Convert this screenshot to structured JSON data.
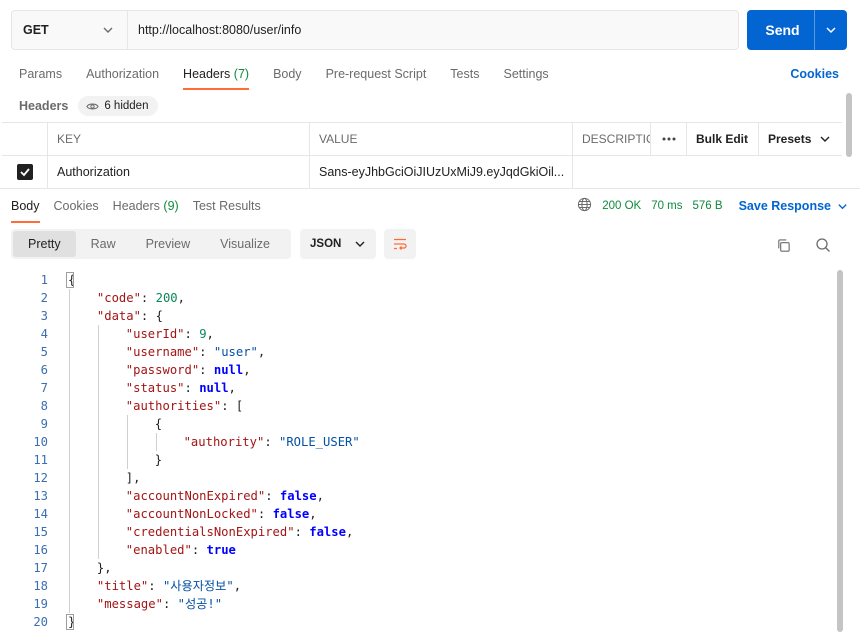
{
  "request": {
    "method": "GET",
    "url": "http://localhost:8080/user/info",
    "send_label": "Send"
  },
  "request_tabs": [
    {
      "label": "Params",
      "count": ""
    },
    {
      "label": "Authorization",
      "count": ""
    },
    {
      "label": "Headers",
      "count": "(7)"
    },
    {
      "label": "Body",
      "count": ""
    },
    {
      "label": "Pre-request Script",
      "count": ""
    },
    {
      "label": "Tests",
      "count": ""
    },
    {
      "label": "Settings",
      "count": ""
    }
  ],
  "cookies_link": "Cookies",
  "headers_section": {
    "title": "Headers",
    "hidden_label": "6 hidden",
    "columns": {
      "key": "KEY",
      "value": "VALUE",
      "description": "DESCRIPTIO"
    },
    "bulk_edit": "Bulk Edit",
    "presets": "Presets",
    "rows": [
      {
        "checked": true,
        "key": "Authorization",
        "value": "Sans-eyJhbGciOiJIUzUxMiJ9.eyJqdGkiOil..."
      }
    ]
  },
  "response_tabs": [
    {
      "label": "Body",
      "count": ""
    },
    {
      "label": "Cookies",
      "count": ""
    },
    {
      "label": "Headers",
      "count": "(9)"
    },
    {
      "label": "Test Results",
      "count": ""
    }
  ],
  "response_meta": {
    "status": "200 OK",
    "time": "70 ms",
    "size": "576 B",
    "save_label": "Save Response"
  },
  "view_modes": [
    "Pretty",
    "Raw",
    "Preview",
    "Visualize"
  ],
  "format": "JSON",
  "code_lines": [
    {
      "n": "1",
      "indent": 0,
      "tokens": [
        [
          "p",
          "{"
        ]
      ]
    },
    {
      "n": "2",
      "indent": 1,
      "tokens": [
        [
          "k",
          "\"code\""
        ],
        [
          "p",
          ": "
        ],
        [
          "n",
          "200"
        ],
        [
          "p",
          ","
        ]
      ]
    },
    {
      "n": "3",
      "indent": 1,
      "tokens": [
        [
          "k",
          "\"data\""
        ],
        [
          "p",
          ": {"
        ]
      ]
    },
    {
      "n": "4",
      "indent": 2,
      "tokens": [
        [
          "k",
          "\"userId\""
        ],
        [
          "p",
          ": "
        ],
        [
          "n",
          "9"
        ],
        [
          "p",
          ","
        ]
      ]
    },
    {
      "n": "5",
      "indent": 2,
      "tokens": [
        [
          "k",
          "\"username\""
        ],
        [
          "p",
          ": "
        ],
        [
          "s",
          "\"user\""
        ],
        [
          "p",
          ","
        ]
      ]
    },
    {
      "n": "6",
      "indent": 2,
      "tokens": [
        [
          "k",
          "\"password\""
        ],
        [
          "p",
          ": "
        ],
        [
          "b",
          "null"
        ],
        [
          "p",
          ","
        ]
      ]
    },
    {
      "n": "7",
      "indent": 2,
      "tokens": [
        [
          "k",
          "\"status\""
        ],
        [
          "p",
          ": "
        ],
        [
          "b",
          "null"
        ],
        [
          "p",
          ","
        ]
      ]
    },
    {
      "n": "8",
      "indent": 2,
      "tokens": [
        [
          "k",
          "\"authorities\""
        ],
        [
          "p",
          ": ["
        ]
      ]
    },
    {
      "n": "9",
      "indent": 3,
      "tokens": [
        [
          "p",
          "{"
        ]
      ]
    },
    {
      "n": "10",
      "indent": 4,
      "tokens": [
        [
          "k",
          "\"authority\""
        ],
        [
          "p",
          ": "
        ],
        [
          "s",
          "\"ROLE_USER\""
        ]
      ]
    },
    {
      "n": "11",
      "indent": 3,
      "tokens": [
        [
          "p",
          "}"
        ]
      ]
    },
    {
      "n": "12",
      "indent": 2,
      "tokens": [
        [
          "p",
          "],"
        ]
      ]
    },
    {
      "n": "13",
      "indent": 2,
      "tokens": [
        [
          "k",
          "\"accountNonExpired\""
        ],
        [
          "p",
          ": "
        ],
        [
          "b",
          "false"
        ],
        [
          "p",
          ","
        ]
      ]
    },
    {
      "n": "14",
      "indent": 2,
      "tokens": [
        [
          "k",
          "\"accountNonLocked\""
        ],
        [
          "p",
          ": "
        ],
        [
          "b",
          "false"
        ],
        [
          "p",
          ","
        ]
      ]
    },
    {
      "n": "15",
      "indent": 2,
      "tokens": [
        [
          "k",
          "\"credentialsNonExpired\""
        ],
        [
          "p",
          ": "
        ],
        [
          "b",
          "false"
        ],
        [
          "p",
          ","
        ]
      ]
    },
    {
      "n": "16",
      "indent": 2,
      "tokens": [
        [
          "k",
          "\"enabled\""
        ],
        [
          "p",
          ": "
        ],
        [
          "b",
          "true"
        ]
      ]
    },
    {
      "n": "17",
      "indent": 1,
      "tokens": [
        [
          "p",
          "},"
        ]
      ]
    },
    {
      "n": "18",
      "indent": 1,
      "tokens": [
        [
          "k",
          "\"title\""
        ],
        [
          "p",
          ": "
        ],
        [
          "s",
          "\"사용자정보\""
        ],
        [
          "p",
          ","
        ]
      ]
    },
    {
      "n": "19",
      "indent": 1,
      "tokens": [
        [
          "k",
          "\"message\""
        ],
        [
          "p",
          ": "
        ],
        [
          "s",
          "\"성공!\""
        ]
      ]
    },
    {
      "n": "20",
      "indent": 0,
      "tokens": [
        [
          "p",
          "}"
        ]
      ]
    }
  ],
  "colors": {
    "accent": "#ff6c37",
    "primary": "#0265d2",
    "success": "#0f8a3c"
  }
}
